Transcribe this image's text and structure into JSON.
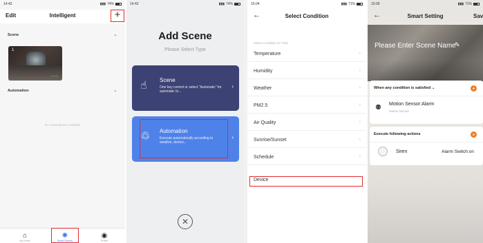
{
  "panel1": {
    "status": {
      "time": "14:42",
      "battery": "74%"
    },
    "header": {
      "edit_label": "Edit",
      "title": "Intelligent",
      "add_label": "+"
    },
    "scene_section": {
      "label": "Scene"
    },
    "scene_card": {
      "index": "1",
      "more": "···"
    },
    "automation_section": {
      "label": "Automation"
    },
    "empty_note": "No Automations Available",
    "tabs": [
      {
        "label": "My Home",
        "icon": "home-icon",
        "active": false
      },
      {
        "label": "Smart Scenes",
        "icon": "smart-scenes-icon",
        "active": true
      },
      {
        "label": "Profile",
        "icon": "profile-icon",
        "active": false
      }
    ]
  },
  "panel2": {
    "status": {
      "time": "14:42",
      "battery": "74%"
    },
    "title": "Add Scene",
    "subtitle": "Please Select Type",
    "scene_card": {
      "title": "Scene",
      "desc": "One key control or select \"Automatic\" for automatic tri..."
    },
    "automation_card": {
      "title": "Automation",
      "desc": "Execute automatically according to weather, device..."
    }
  },
  "panel3": {
    "status": {
      "time": "15:04",
      "battery": "71%"
    },
    "title": "Select Condition",
    "hint": "Select Condition for Task",
    "conditions": [
      "Temperature",
      "Humidity",
      "Weather",
      "PM2.5",
      "Air Quality",
      "Sunrise/Sunset",
      "Schedule",
      "Device"
    ]
  },
  "panel4": {
    "status": {
      "time": "15:05",
      "battery": "71%"
    },
    "title": "Smart Setting",
    "save_label": "Save",
    "name_placeholder": "Please Enter Scene Name",
    "condition_card": {
      "header": "When any condition is satisfied",
      "item_title": "Motion Sensor:Alarm",
      "item_sub": "Motion Sensor"
    },
    "action_card": {
      "header": "Execute following actions",
      "item_title": "Siren",
      "item_value": "Alarm Switch:on"
    }
  }
}
